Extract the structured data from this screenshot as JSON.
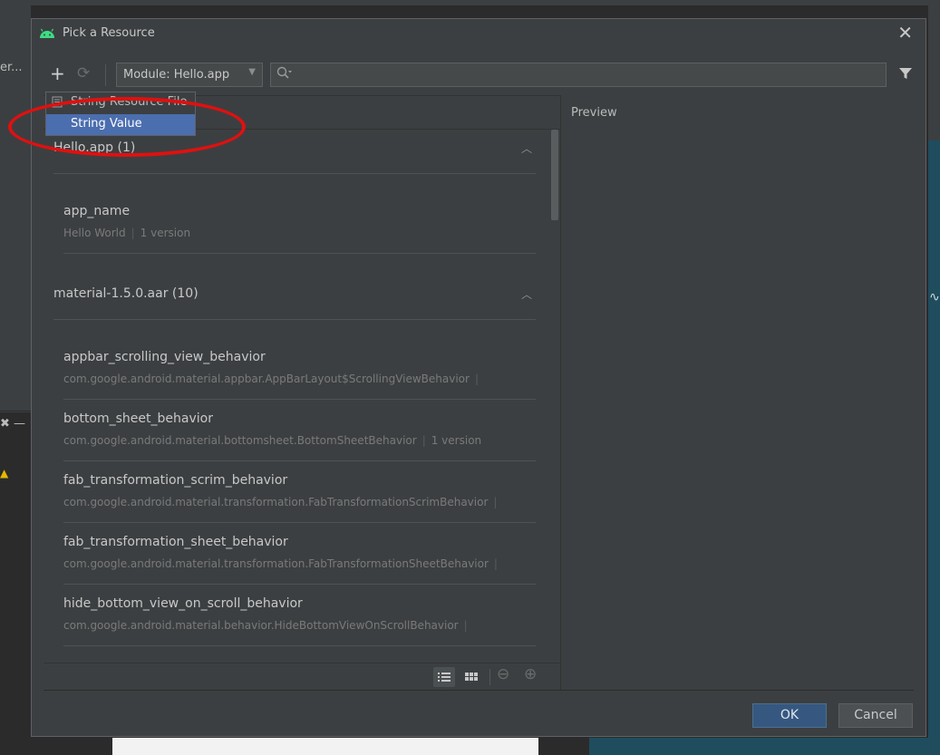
{
  "background": {
    "left_text": "er...",
    "left_close": "✖ —",
    "right_glyph": "∿"
  },
  "dialog": {
    "title": "Pick a Resource",
    "close_glyph": "✕"
  },
  "toolbar": {
    "add_glyph": "+",
    "refresh_glyph": "⟳",
    "module_label": "Module: Hello.app",
    "module_arrow": "▼",
    "search_placeholder": "",
    "search_value": ""
  },
  "popup": {
    "items": [
      {
        "label": "String Resource File"
      },
      {
        "label": "String Value",
        "selected": true
      }
    ]
  },
  "sections": [
    {
      "title": "Hello.app (1)",
      "chevron": "︿",
      "items": [
        {
          "name": "app_name",
          "value": "Hello World",
          "version": "1 version"
        }
      ]
    },
    {
      "title": "material-1.5.0.aar (10)",
      "chevron": "︿",
      "items": [
        {
          "name": "appbar_scrolling_view_behavior",
          "value": "com.google.android.material.appbar.AppBarLayout$ScrollingViewBehavior",
          "version": ""
        },
        {
          "name": "bottom_sheet_behavior",
          "value": "com.google.android.material.bottomsheet.BottomSheetBehavior",
          "version": "1 version"
        },
        {
          "name": "fab_transformation_scrim_behavior",
          "value": "com.google.android.material.transformation.FabTransformationScrimBehavior",
          "version": ""
        },
        {
          "name": "fab_transformation_sheet_behavior",
          "value": "com.google.android.material.transformation.FabTransformationSheetBehavior",
          "version": ""
        },
        {
          "name": "hide_bottom_view_on_scroll_behavior",
          "value": "com.google.android.material.behavior.HideBottomViewOnScrollBehavior",
          "version": ""
        }
      ]
    }
  ],
  "separator": "|",
  "bottom_bar": {
    "minus_glyph": "⊖",
    "plus_glyph": "⊕"
  },
  "preview": {
    "label": "Preview"
  },
  "buttons": {
    "ok": "OK",
    "cancel": "Cancel"
  },
  "colors": {
    "accent": "#365880",
    "selection": "#4b6eaf",
    "annotation": "#e01010",
    "android_green": "#3ddc84"
  }
}
